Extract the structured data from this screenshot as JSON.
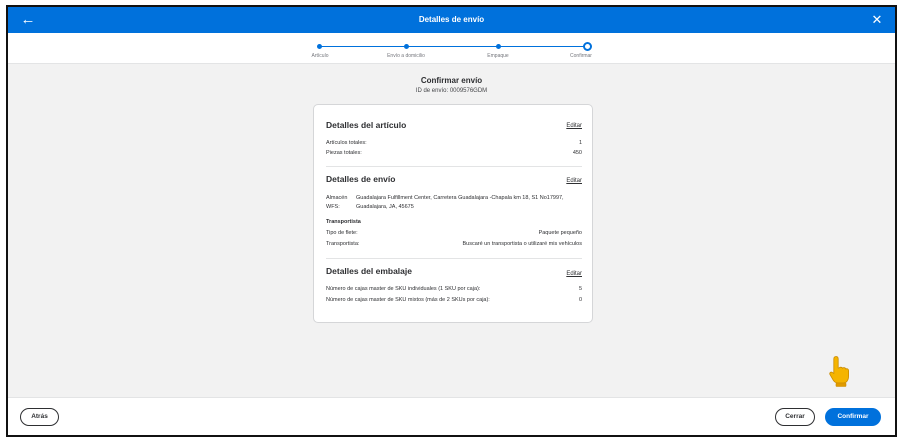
{
  "header": {
    "title": "Detalles de envío",
    "back_icon": "←",
    "close_icon": "✕",
    "color": "#0071dc"
  },
  "stepper": {
    "steps": [
      {
        "label": "Artículo",
        "state": "done"
      },
      {
        "label": "Envío a domicilio",
        "state": "done"
      },
      {
        "label": "Empaque",
        "state": "done"
      },
      {
        "label": "Confirmar",
        "state": "current"
      }
    ]
  },
  "page": {
    "title": "Confirmar envío",
    "shipment_id": "ID de envío: 0009576GDM"
  },
  "items_section": {
    "title": "Detalles del artículo",
    "edit_label": "Editar",
    "rows": [
      {
        "label": "Artículos totales:",
        "value": "1"
      },
      {
        "label": "Piezas totales:",
        "value": "450"
      }
    ]
  },
  "shipping_section": {
    "title": "Detalles de envío",
    "edit_label": "Editar",
    "warehouse_label": "Almacén WFS:",
    "warehouse_value": "Guadalajara Fulfillment Center, Carretera Guadalajara -Chapala km 18, S1 No17997, Guadalajara, JA, 45675",
    "carrier_heading": "Transportista",
    "rows": [
      {
        "label": "Tipo de flete:",
        "value": "Paquete pequeño"
      },
      {
        "label": "Transportista:",
        "value": "Buscaré un transportista o utilizaré mis vehículos"
      }
    ]
  },
  "packing_section": {
    "title": "Detalles del embalaje",
    "edit_label": "Editar",
    "rows": [
      {
        "label": "Número de cajas master de SKU individuales (1 SKU por caja):",
        "value": "5"
      },
      {
        "label": "Número de cajas master de SKU mixtos (más de 2 SKUs por caja):",
        "value": "0"
      }
    ]
  },
  "footer": {
    "back_label": "Atrás",
    "close_label": "Cerrar",
    "confirm_label": "Confirmar"
  },
  "pointer": {
    "icon": "pointing-hand-icon",
    "color": "#f5b400"
  }
}
